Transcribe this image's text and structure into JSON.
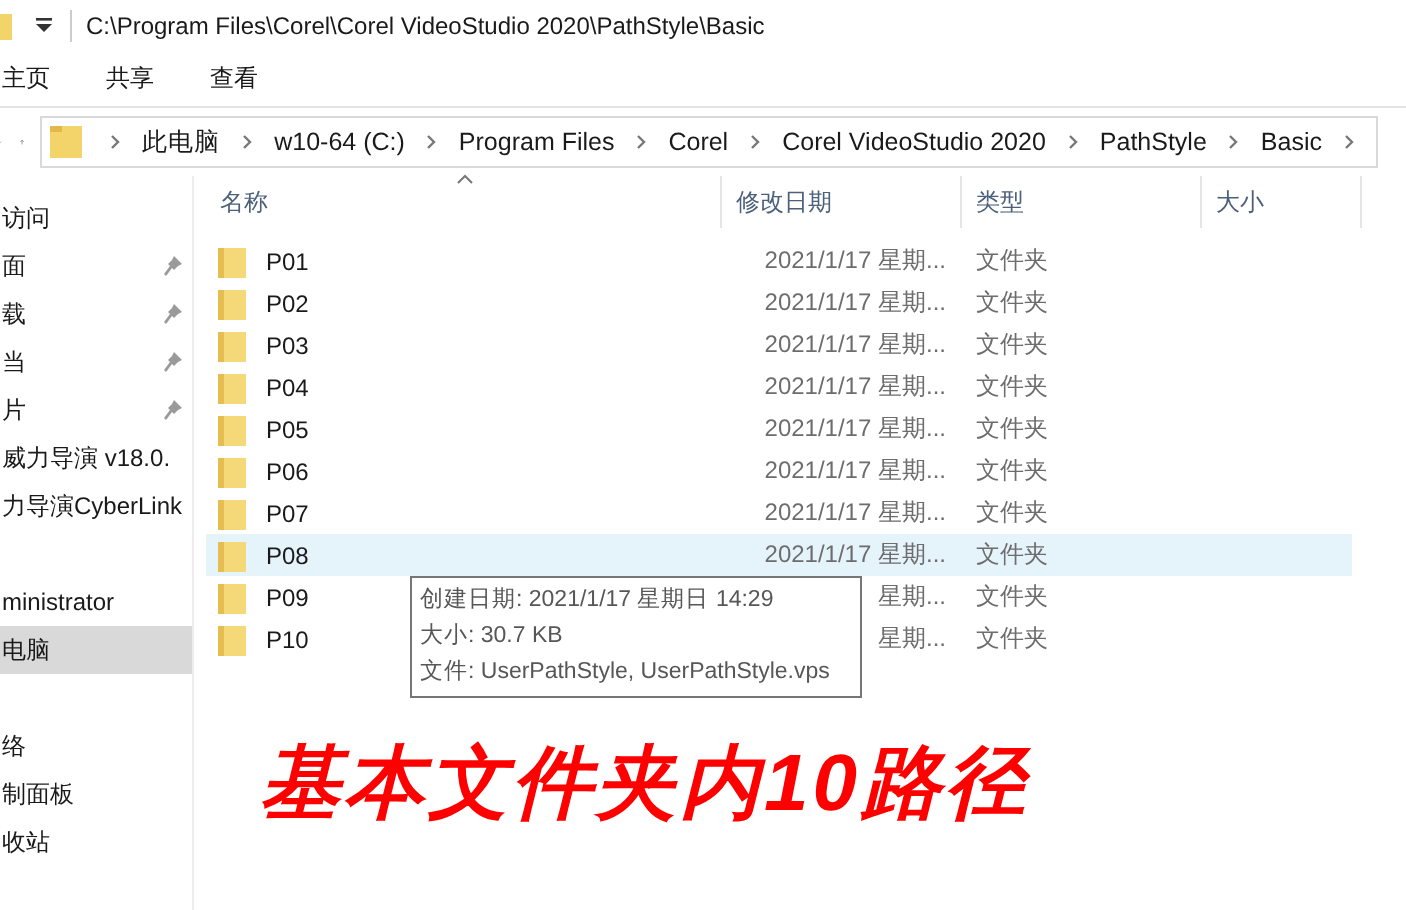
{
  "title_bar": {
    "path": "C:\\Program Files\\Corel\\Corel VideoStudio 2020\\PathStyle\\Basic"
  },
  "ribbon_tabs": [
    {
      "label": "主页"
    },
    {
      "label": "共享"
    },
    {
      "label": "查看"
    }
  ],
  "address_bar": {
    "crumbs": [
      "此电脑",
      "w10-64 (C:)",
      "Program Files",
      "Corel",
      "Corel VideoStudio 2020",
      "PathStyle",
      "Basic"
    ]
  },
  "sidebar": {
    "groups": [
      [
        {
          "label": "访问",
          "pinned": false,
          "selected": false
        },
        {
          "label": "面",
          "pinned": true,
          "selected": false
        },
        {
          "label": "载",
          "pinned": true,
          "selected": false
        },
        {
          "label": "当",
          "pinned": true,
          "selected": false
        },
        {
          "label": "片",
          "pinned": true,
          "selected": false
        },
        {
          "label": "威力导演 v18.0.",
          "pinned": false,
          "selected": false
        },
        {
          "label": "力导演CyberLink",
          "pinned": false,
          "selected": false
        }
      ],
      [
        {
          "label": "ministrator",
          "pinned": false,
          "selected": false
        },
        {
          "label": "电脑",
          "pinned": false,
          "selected": true
        }
      ],
      [
        {
          "label": "络",
          "pinned": false,
          "selected": false
        },
        {
          "label": "制面板",
          "pinned": false,
          "selected": false
        },
        {
          "label": "收站",
          "pinned": false,
          "selected": false
        }
      ]
    ]
  },
  "columns": [
    {
      "label": "名称",
      "sorted": true
    },
    {
      "label": "修改日期",
      "sorted": false
    },
    {
      "label": "类型",
      "sorted": false
    },
    {
      "label": "大小",
      "sorted": false
    }
  ],
  "rows": [
    {
      "name": "P01",
      "modified": "2021/1/17 星期...",
      "type": "文件夹",
      "selected": false
    },
    {
      "name": "P02",
      "modified": "2021/1/17 星期...",
      "type": "文件夹",
      "selected": false
    },
    {
      "name": "P03",
      "modified": "2021/1/17 星期...",
      "type": "文件夹",
      "selected": false
    },
    {
      "name": "P04",
      "modified": "2021/1/17 星期...",
      "type": "文件夹",
      "selected": false
    },
    {
      "name": "P05",
      "modified": "2021/1/17 星期...",
      "type": "文件夹",
      "selected": false
    },
    {
      "name": "P06",
      "modified": "2021/1/17 星期...",
      "type": "文件夹",
      "selected": false
    },
    {
      "name": "P07",
      "modified": "2021/1/17 星期...",
      "type": "文件夹",
      "selected": false
    },
    {
      "name": "P08",
      "modified": "2021/1/17 星期...",
      "type": "文件夹",
      "selected": true
    },
    {
      "name": "P09",
      "modified": "星期...",
      "type": "文件夹",
      "selected": false
    },
    {
      "name": "P10",
      "modified": "星期...",
      "type": "文件夹",
      "selected": false
    }
  ],
  "tooltip": {
    "lines": [
      "创建日期: 2021/1/17 星期日 14:29",
      "大小: 30.7 KB",
      "文件: UserPathStyle, UserPathStyle.vps"
    ]
  },
  "caption": "基本文件夹内10路径"
}
